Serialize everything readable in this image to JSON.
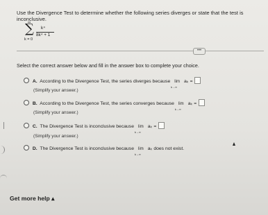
{
  "instruction": "Use the Divergence Test to determine whether the following series diverges or state that the test is inconclusive.",
  "series": {
    "upper": "∞",
    "sigma": "∑",
    "lower": "k = 0",
    "numerator": "k⁴",
    "denominator": "8k⁴ + 1"
  },
  "more_button": "•••",
  "select_prompt": "Select the correct answer below and fill in the answer box to complete your choice.",
  "options": [
    {
      "letter": "A.",
      "text": "According to the Divergence Test, the series diverges because",
      "lim": "lim",
      "lim_sub": "k→∞",
      "term": "aₖ =",
      "note": "(Simplify your answer.)"
    },
    {
      "letter": "B.",
      "text": "According to the Divergence Test, the series converges because",
      "lim": "lim",
      "lim_sub": "k→∞",
      "term": "aₖ =",
      "note": "(Simplify your answer.)"
    },
    {
      "letter": "C.",
      "text": "The Divergence Test is inconclusive because",
      "lim": "lim",
      "lim_sub": "k→∞",
      "term": "aₖ =",
      "note": "(Simplify your answer.)"
    },
    {
      "letter": "D.",
      "text": "The Divergence Test is inconclusive because",
      "lim": "lim",
      "lim_sub": "k→∞",
      "term": "aₖ",
      "tail": "does not exist."
    }
  ],
  "help": "Get more help ▴"
}
